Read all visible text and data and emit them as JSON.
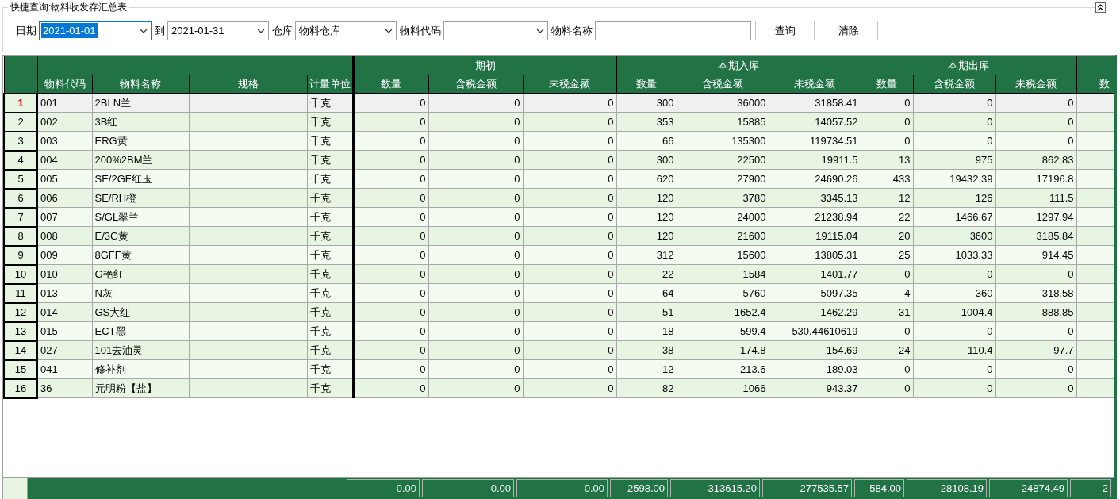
{
  "panel": {
    "title": "快捷查询:物料收发存汇总表",
    "fields": [
      {
        "kind": "combo",
        "label": "日期",
        "value": "2021-01-01",
        "selected": true
      },
      {
        "kind": "combo",
        "label": "到",
        "value": "2021-01-31",
        "selected": false
      },
      {
        "kind": "combo",
        "label": "仓库",
        "value": "物料仓库",
        "selected": false
      },
      {
        "kind": "combo",
        "label": "物料代码",
        "selected": false
      },
      {
        "kind": "text",
        "label": "物料名称",
        "selected": false
      }
    ],
    "buttons": [
      "查询",
      "清除"
    ]
  },
  "table": {
    "groups": [
      {
        "columns": [
          "物料代码",
          "物料名称",
          "规格",
          "计量单位"
        ]
      },
      {
        "label": "期初",
        "columns": [
          "数量",
          "含税金额",
          "未税金额"
        ]
      },
      {
        "label": "本期入库",
        "columns": [
          "数量",
          "含税金额",
          "未税金额"
        ]
      },
      {
        "label": "本期出库",
        "columns": [
          "数量",
          "含税金额",
          "未税金额"
        ]
      },
      {
        "columns": [
          "数"
        ]
      }
    ],
    "rows": [
      {
        "number": "1",
        "selected": true,
        "code": "001",
        "name": "2BLN兰",
        "unit": "千克",
        "values": [
          "0",
          "0",
          "0",
          "300",
          "36000",
          "31858.41",
          "0",
          "0",
          "0"
        ]
      },
      {
        "number": "2",
        "selected": false,
        "code": "002",
        "name": "3B红",
        "unit": "千克",
        "values": [
          "0",
          "0",
          "0",
          "353",
          "15885",
          "14057.52",
          "0",
          "0",
          "0"
        ]
      },
      {
        "number": "3",
        "selected": false,
        "code": "003",
        "name": "ERG黄",
        "unit": "千克",
        "values": [
          "0",
          "0",
          "0",
          "66",
          "135300",
          "119734.51",
          "0",
          "0",
          "0"
        ]
      },
      {
        "number": "4",
        "selected": false,
        "code": "004",
        "name": "200%2BM兰",
        "unit": "千克",
        "values": [
          "0",
          "0",
          "0",
          "300",
          "22500",
          "19911.5",
          "13",
          "975",
          "862.83"
        ]
      },
      {
        "number": "5",
        "selected": false,
        "code": "005",
        "name": "SE/2GF红玉",
        "unit": "千克",
        "values": [
          "0",
          "0",
          "0",
          "620",
          "27900",
          "24690.26",
          "433",
          "19432.39",
          "17196.8"
        ]
      },
      {
        "number": "6",
        "selected": false,
        "code": "006",
        "name": "SE/RH橙",
        "unit": "千克",
        "values": [
          "0",
          "0",
          "0",
          "120",
          "3780",
          "3345.13",
          "12",
          "126",
          "111.5"
        ]
      },
      {
        "number": "7",
        "selected": false,
        "code": "007",
        "name": "S/GL翠兰",
        "unit": "千克",
        "values": [
          "0",
          "0",
          "0",
          "120",
          "24000",
          "21238.94",
          "22",
          "1466.67",
          "1297.94"
        ]
      },
      {
        "number": "8",
        "selected": false,
        "code": "008",
        "name": "E/3G黄",
        "unit": "千克",
        "values": [
          "0",
          "0",
          "0",
          "120",
          "21600",
          "19115.04",
          "20",
          "3600",
          "3185.84"
        ]
      },
      {
        "number": "9",
        "selected": false,
        "code": "009",
        "name": "8GFF黄",
        "unit": "千克",
        "values": [
          "0",
          "0",
          "0",
          "312",
          "15600",
          "13805.31",
          "25",
          "1033.33",
          "914.45"
        ]
      },
      {
        "number": "10",
        "selected": false,
        "code": "010",
        "name": "G艳红",
        "unit": "千克",
        "values": [
          "0",
          "0",
          "0",
          "22",
          "1584",
          "1401.77",
          "0",
          "0",
          "0"
        ]
      },
      {
        "number": "11",
        "selected": false,
        "code": "013",
        "name": "N灰",
        "unit": "千克",
        "values": [
          "0",
          "0",
          "0",
          "64",
          "5760",
          "5097.35",
          "4",
          "360",
          "318.58"
        ]
      },
      {
        "number": "12",
        "selected": false,
        "code": "014",
        "name": "GS大红",
        "unit": "千克",
        "values": [
          "0",
          "0",
          "0",
          "51",
          "1652.4",
          "1462.29",
          "31",
          "1004.4",
          "888.85"
        ]
      },
      {
        "number": "13",
        "selected": false,
        "code": "015",
        "name": "ECT黑",
        "unit": "千克",
        "values": [
          "0",
          "0",
          "0",
          "18",
          "599.4",
          "530.44610619",
          "0",
          "0",
          "0"
        ]
      },
      {
        "number": "14",
        "selected": false,
        "code": "027",
        "name": "101去油灵",
        "unit": "千克",
        "values": [
          "0",
          "0",
          "0",
          "38",
          "174.8",
          "154.69",
          "24",
          "110.4",
          "97.7"
        ]
      },
      {
        "number": "15",
        "selected": false,
        "code": "041",
        "name": "修补剂",
        "unit": "千克",
        "values": [
          "0",
          "0",
          "0",
          "12",
          "213.6",
          "189.03",
          "0",
          "0",
          "0"
        ]
      },
      {
        "number": "16",
        "selected": false,
        "code": "36",
        "name": "元明粉【盐】",
        "unit": "千克",
        "values": [
          "0",
          "0",
          "0",
          "82",
          "1066",
          "943.37",
          "0",
          "0",
          "0"
        ]
      }
    ],
    "totals": [
      "0.00",
      "0.00",
      "0.00",
      "2598.00",
      "313615.20",
      "277535.57",
      "584.00",
      "28108.19",
      "24874.49",
      "2"
    ]
  }
}
